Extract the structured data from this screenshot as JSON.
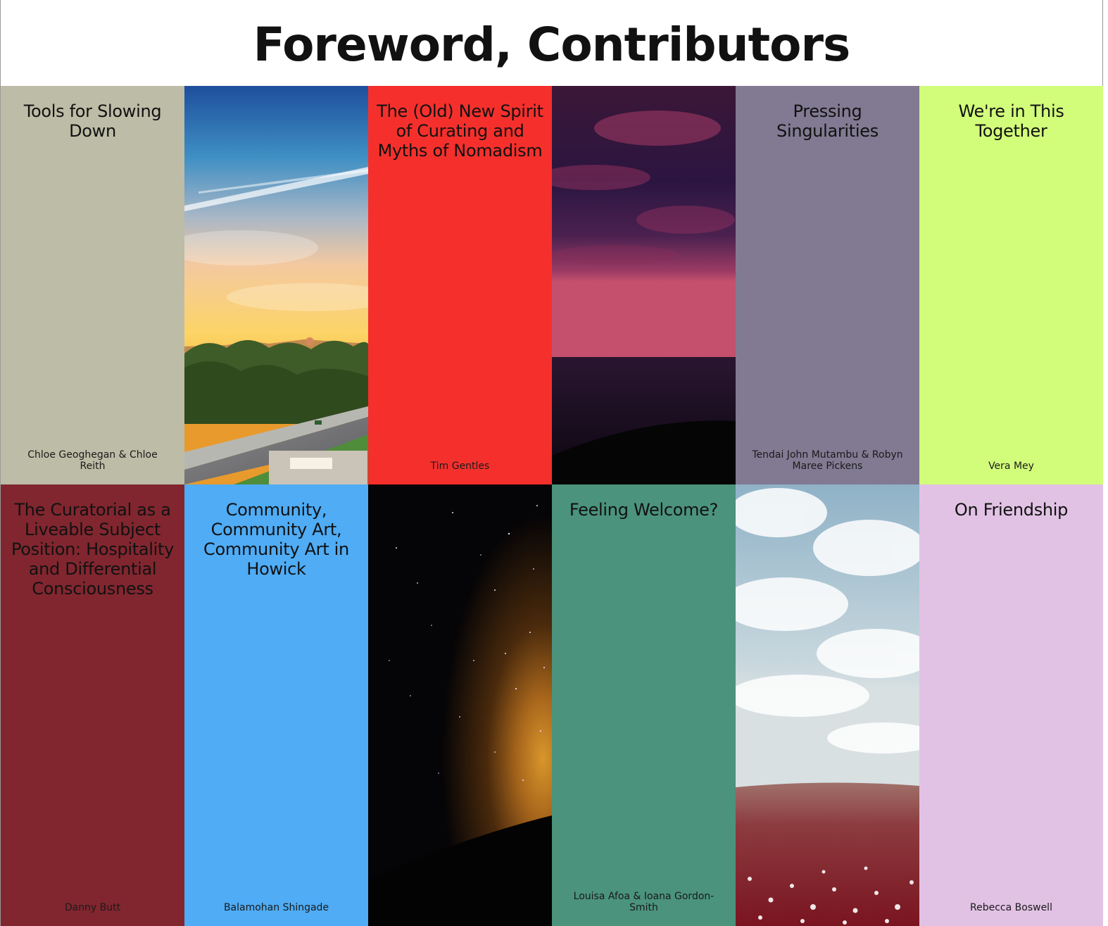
{
  "page": {
    "title": "Foreword, Contributors"
  },
  "tiles": [
    {
      "title": "Tools for Slowing Down",
      "author": "Chloe Geoghegan & Chloe Reith",
      "color": "#bdbca6"
    },
    {
      "image": "sunset-city-photo"
    },
    {
      "title": "The (Old) New Spirit of Curating and Myths of Nomadism",
      "author": "Tim Gentles",
      "color": "#f5302c"
    },
    {
      "image": "purple-sea-sky-photo"
    },
    {
      "title": "Pressing Singularities",
      "author": "Tendai John Mutambu & Robyn Maree Pickens",
      "color": "#817a92"
    },
    {
      "title": "We're in This Together",
      "author": "Vera Mey",
      "color": "#d2fd7b"
    },
    {
      "title": "The Curatorial as a Liveable Subject Position: Hospitality and Differential Consciousness",
      "author": "Danny Butt",
      "color": "#81262f"
    },
    {
      "title": "Community, Community Art, Community Art in Howick",
      "author": "Balamohan Shingade",
      "color": "#4facf5"
    },
    {
      "image": "starfield-glow-photo"
    },
    {
      "title": "Feeling Welcome?",
      "author": "Louisa Afoa & Ioana Gordon-Smith",
      "color": "#4b937c"
    },
    {
      "image": "cloudy-sky-red-field-photo"
    },
    {
      "title": "On Friendship",
      "author": "Rebecca Boswell",
      "color": "#e1c2e4"
    }
  ]
}
